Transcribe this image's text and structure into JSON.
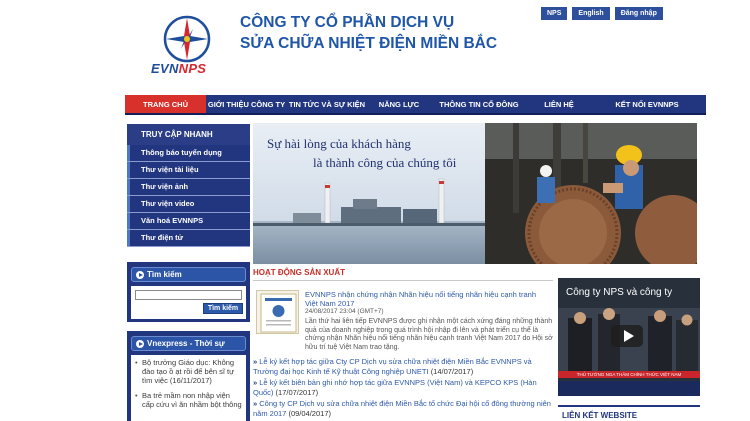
{
  "header": {
    "logo_text_blue": "EVN",
    "logo_text_red": "NPS",
    "company_line1": "CÔNG TY CỔ PHẦN DỊCH  VỤ",
    "company_line2": "SỬA CHỮA NHIỆT ĐIỆN MIỀN BẮC"
  },
  "topbar": {
    "nps": "NPS",
    "english": "English",
    "login": "Đăng nhập"
  },
  "menu": [
    "TRANG CHỦ",
    "GIỚI THIỆU CÔNG TY",
    "TIN TỨC VÀ SỰ KIỆN",
    "NĂNG LỰC",
    "THÔNG TIN CỔ ĐÔNG",
    "LIÊN HỆ",
    "KẾT NỐI EVNNPS"
  ],
  "quick_access": {
    "title": "TRUY CẬP NHANH",
    "items": [
      "Thông báo tuyển dụng",
      "Thư viện tài liệu",
      "Thư viện ảnh",
      "Thư viện video",
      "Văn hoá EVNNPS",
      "Thư điện tử"
    ]
  },
  "search": {
    "title": "Tìm kiếm",
    "button": "Tìm kiếm",
    "value": ""
  },
  "vnexpress": {
    "title": "Vnexpress - Thời sự",
    "items": [
      "Bộ trưởng Giáo dục: Không đào tạo ồ ạt rồi để bên sĩ tự tìm việc (16/11/2017)",
      "Ba trẻ mầm non nhập viện cấp cứu vì ăn nhầm bột thông"
    ]
  },
  "banner": {
    "slogan_line1": "Sự hài lòng của khách hàng",
    "slogan_line2": "là thành công của chúng tôi"
  },
  "main": {
    "section_title": "HOẠT ĐỘNG SẢN XUẤT",
    "featured": {
      "title": "EVNNPS nhận chứng nhận Nhãn hiệu nổi tiếng nhãn hiệu cạnh tranh Việt Nam 2017",
      "date": "24/08/2017 23:04 (GMT+7)",
      "summary": "Lần thứ hai liên tiếp EVNNPS được ghi nhận một cách xứng đáng những thành quả của doanh nghiệp trong quá trình hội nhập đi lên và phát triển cụ thể là chứng nhận Nhãn hiệu nổi tiếng nhãn hiệu cạnh tranh Việt Nam 2017 do Hội sở hữu trí tuệ Việt Nam trao tặng."
    },
    "links": [
      {
        "arrow": "»",
        "text": "Lễ ký kết hợp tác giữa Cty CP Dịch vụ sửa chữa nhiệt điện Miền Bắc EVNNPS và Trường đại học Kinh tế Kỹ thuật Công nghiệp UNETI",
        "date": "(14/07/2017)"
      },
      {
        "arrow": "»",
        "text": "Lễ ký kết biên bản ghi nhớ hợp tác giữa EVNNPS (Việt Nam) và KEPCO KPS (Hàn Quốc)",
        "date": "(17/07/2017)"
      },
      {
        "arrow": "»",
        "text": "Công ty CP Dịch vụ sửa chữa nhiệt điện Miền Bắc tổ chức Đại hội cổ đông thường niên năm 2017",
        "date": "(09/04/2017)"
      }
    ]
  },
  "video": {
    "title": "Công ty NPS và công ty",
    "caption": "THỦ TƯỚNG NGA THĂM CHÍNH THỨC VIỆT NAM"
  },
  "links_section": {
    "title": "LIÊN KẾT WEBSITE"
  }
}
